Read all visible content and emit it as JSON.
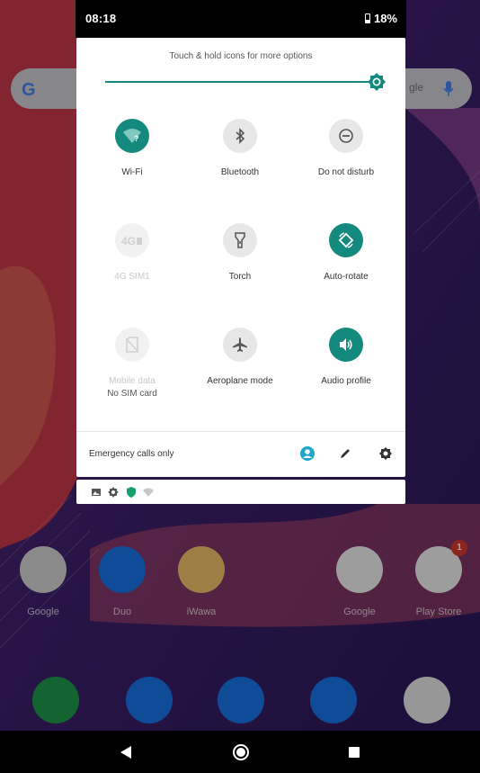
{
  "status_bar": {
    "time": "08:18",
    "battery": "18%"
  },
  "quick_settings": {
    "hint": "Touch & hold icons for more options",
    "brightness_level": 1.0,
    "tiles": [
      {
        "name": "Wi-Fi",
        "state": "on",
        "icon": "wifi-question-icon"
      },
      {
        "name": "Bluetooth",
        "state": "off",
        "icon": "bluetooth-icon"
      },
      {
        "name": "Do not disturb",
        "state": "off",
        "icon": "do-not-disturb-icon"
      },
      {
        "name": "4G SIM1",
        "state": "disabled",
        "icon": "4g-icon"
      },
      {
        "name": "Torch",
        "state": "off",
        "icon": "torch-icon"
      },
      {
        "name": "Auto-rotate",
        "state": "on",
        "icon": "auto-rotate-icon"
      },
      {
        "name": "Mobile data",
        "sub": "No SIM card",
        "state": "disabled",
        "icon": "mobile-data-icon"
      },
      {
        "name": "Aeroplane mode",
        "state": "off",
        "icon": "airplane-icon"
      },
      {
        "name": "Audio profile",
        "state": "on",
        "icon": "audio-profile-icon"
      }
    ],
    "footer": {
      "text": "Emergency calls only",
      "icons": [
        "user-icon",
        "edit-icon",
        "settings-icon"
      ]
    }
  },
  "colors": {
    "accent": "#14897d",
    "tile_off": "#e7e7e7"
  },
  "home": {
    "apps": [
      "Google",
      "Duo",
      "iWawa",
      "Google",
      "Play Store"
    ],
    "play_store_badge": "1",
    "search_hint": "gle"
  }
}
